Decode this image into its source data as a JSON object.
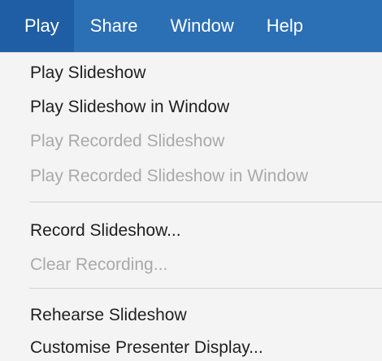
{
  "menubar": {
    "items": [
      {
        "label": "Play",
        "active": true
      },
      {
        "label": "Share",
        "active": false
      },
      {
        "label": "Window",
        "active": false
      },
      {
        "label": "Help",
        "active": false
      }
    ]
  },
  "dropdown": {
    "items": [
      {
        "label": "Play Slideshow",
        "enabled": true
      },
      {
        "label": "Play Slideshow in Window",
        "enabled": true
      },
      {
        "label": "Play Recorded Slideshow",
        "enabled": false
      },
      {
        "label": "Play Recorded Slideshow in Window",
        "enabled": false
      },
      {
        "label": "Record Slideshow...",
        "enabled": true
      },
      {
        "label": "Clear Recording...",
        "enabled": false
      },
      {
        "label": "Rehearse Slideshow",
        "enabled": true
      },
      {
        "label": "Customise Presenter Display...",
        "enabled": true
      }
    ]
  },
  "colors": {
    "menubar_bg": "#2b6fb4",
    "menubar_active_bg": "#1f5ea4",
    "menu_bg": "#f4f4f4",
    "text": "#1f1f1f",
    "disabled_text": "#a9a9a9",
    "separator": "#d2d2d2"
  }
}
